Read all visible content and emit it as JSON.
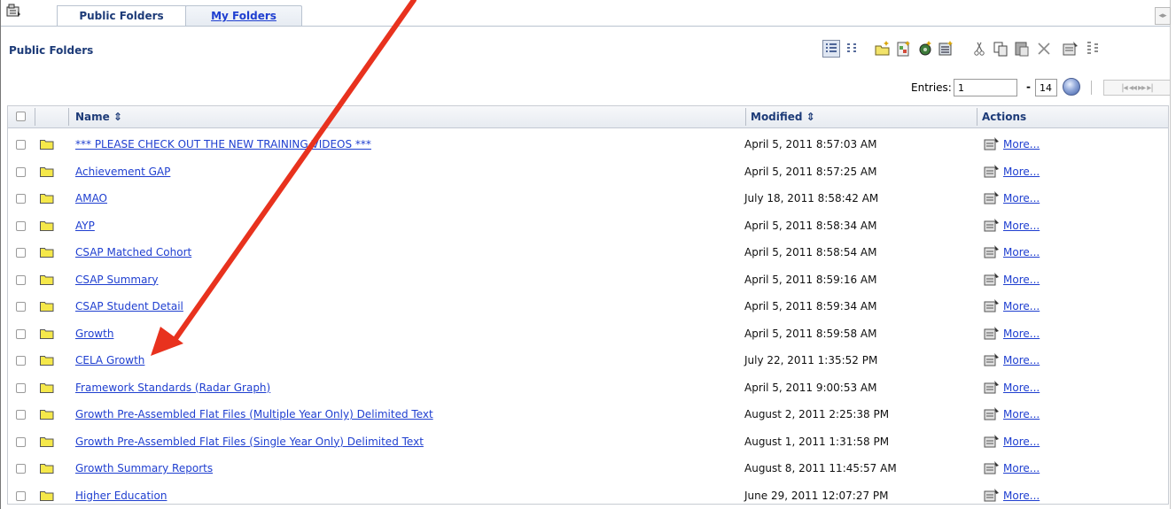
{
  "tabs": [
    {
      "label": "Public Folders",
      "active": true
    },
    {
      "label": "My Folders",
      "active": false
    }
  ],
  "header": {
    "title": "Public Folders"
  },
  "toolbar": {
    "icons": [
      "list-view-icon",
      "details-view-icon",
      "new-folder-icon",
      "new-page-icon",
      "new-job-icon",
      "new-url-icon",
      "cut-icon",
      "copy-icon",
      "paste-icon",
      "delete-icon",
      "set-properties-icon",
      "order-icon"
    ]
  },
  "entries": {
    "label": "Entries:",
    "from": "1",
    "to": "14",
    "dash": "-"
  },
  "columns": {
    "name": "Name ⇕",
    "modified": "Modified ⇕",
    "actions": "Actions"
  },
  "rows": [
    {
      "name": "*** PLEASE CHECK OUT THE NEW TRAINING VIDEOS ***",
      "modified": "April 5, 2011 8:57:03 AM",
      "action": "More..."
    },
    {
      "name": "Achievement GAP",
      "modified": "April 5, 2011 8:57:25 AM",
      "action": "More..."
    },
    {
      "name": "AMAO",
      "modified": "July 18, 2011 8:58:42 AM",
      "action": "More..."
    },
    {
      "name": "AYP",
      "modified": "April 5, 2011 8:58:34 AM",
      "action": "More..."
    },
    {
      "name": "CSAP Matched Cohort",
      "modified": "April 5, 2011 8:58:54 AM",
      "action": "More..."
    },
    {
      "name": "CSAP Summary",
      "modified": "April 5, 2011 8:59:16 AM",
      "action": "More..."
    },
    {
      "name": "CSAP Student Detail",
      "modified": "April 5, 2011 8:59:34 AM",
      "action": "More..."
    },
    {
      "name": "Growth",
      "modified": "April 5, 2011 8:59:58 AM",
      "action": "More..."
    },
    {
      "name": "CELA Growth",
      "modified": "July 22, 2011 1:35:52 PM",
      "action": "More..."
    },
    {
      "name": "Framework Standards (Radar Graph)",
      "modified": "April 5, 2011 9:00:53 AM",
      "action": "More..."
    },
    {
      "name": "Growth Pre-Assembled Flat Files (Multiple Year Only) Delimited Text",
      "modified": "August 2, 2011 2:25:38 PM",
      "action": "More..."
    },
    {
      "name": "Growth Pre-Assembled Flat Files (Single Year Only) Delimited Text",
      "modified": "August 1, 2011 1:31:58 PM",
      "action": "More..."
    },
    {
      "name": "Growth Summary Reports",
      "modified": "August 8, 2011 11:45:57 AM",
      "action": "More..."
    },
    {
      "name": "Higher Education",
      "modified": "June 29, 2011 12:07:27 PM",
      "action": "More..."
    }
  ],
  "colors": {
    "link": "#1f3fd0",
    "header_text": "#1d3b78",
    "arrow": "#e8321e",
    "folder": "#f5e84a"
  }
}
